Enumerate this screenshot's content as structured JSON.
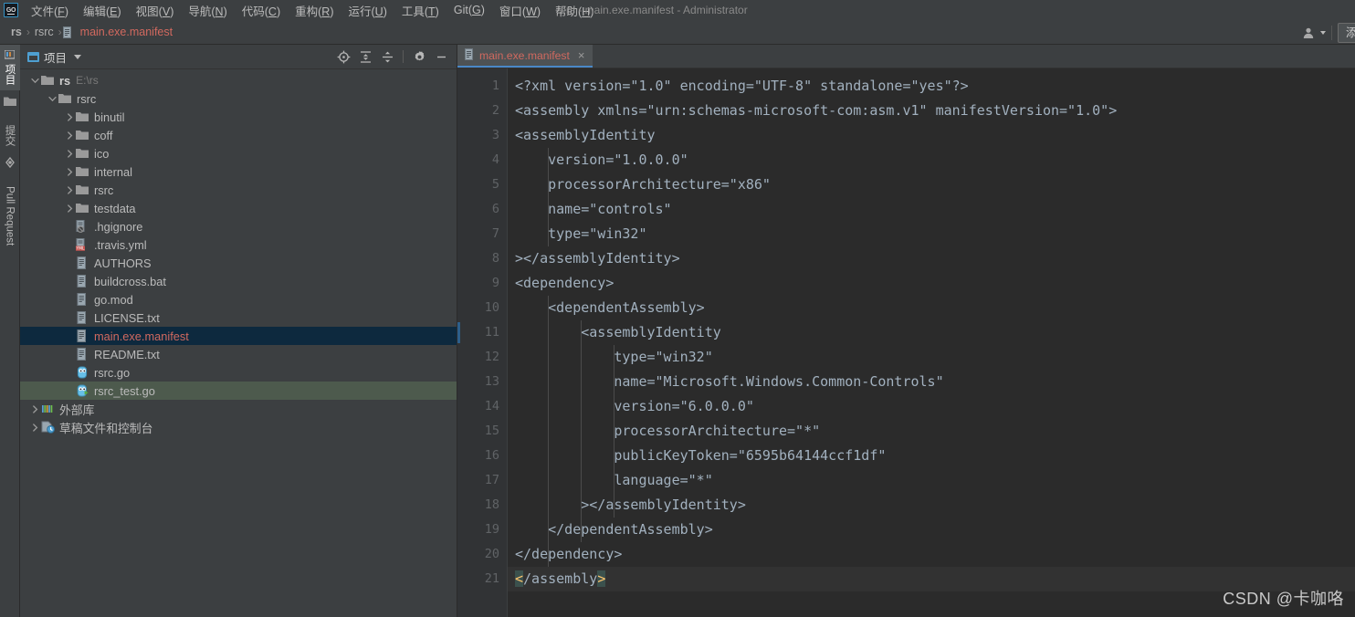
{
  "window": {
    "title": "rs - main.exe.manifest - Administrator",
    "logo_label": "GO"
  },
  "menubar": {
    "items": [
      {
        "label": "文件(F)",
        "name": "menu-file"
      },
      {
        "label": "编辑(E)",
        "name": "menu-edit"
      },
      {
        "label": "视图(V)",
        "name": "menu-view"
      },
      {
        "label": "导航(N)",
        "name": "menu-navigate"
      },
      {
        "label": "代码(C)",
        "name": "menu-code"
      },
      {
        "label": "重构(R)",
        "name": "menu-refactor"
      },
      {
        "label": "运行(U)",
        "name": "menu-run"
      },
      {
        "label": "工具(T)",
        "name": "menu-tools"
      },
      {
        "label": "Git(G)",
        "name": "menu-git"
      },
      {
        "label": "窗口(W)",
        "name": "menu-window"
      },
      {
        "label": "帮助(H)",
        "name": "menu-help"
      }
    ]
  },
  "breadcrumb": {
    "root": "rs",
    "folder": "rsrc",
    "file": "main.exe.manifest",
    "separator": "›"
  },
  "navbar_right": {
    "person_icon": "person-icon",
    "add_button_label": "添加"
  },
  "toolstrip": {
    "items": [
      {
        "label": "项目",
        "name": "toolwindow-project",
        "selected": true
      },
      {
        "label": "",
        "name": "toolwindow-folder",
        "icon": "folder-icon"
      },
      {
        "label": "提交",
        "name": "toolwindow-commit"
      },
      {
        "label": "",
        "name": "toolwindow-structure",
        "icon": "diamond-icon"
      },
      {
        "label": "Pull Request",
        "name": "toolwindow-pull-request"
      }
    ]
  },
  "project_panel": {
    "title": "项目",
    "tools": [
      {
        "name": "locate-icon",
        "title": "select-opened-file"
      },
      {
        "name": "expand-all-icon",
        "title": "expand-all"
      },
      {
        "name": "collapse-all-icon",
        "title": "collapse-all"
      },
      {
        "name": "gear-icon",
        "title": "settings"
      },
      {
        "name": "minimize-icon",
        "title": "hide"
      }
    ],
    "tree": [
      {
        "label": "rs",
        "sub": "E:\\rs",
        "depth": 0,
        "type": "module",
        "state": "expanded",
        "bold": true
      },
      {
        "label": "rsrc",
        "sub": "",
        "depth": 1,
        "type": "folder",
        "state": "expanded"
      },
      {
        "label": "binutil",
        "sub": "",
        "depth": 2,
        "type": "folder",
        "state": "collapsed"
      },
      {
        "label": "coff",
        "sub": "",
        "depth": 2,
        "type": "folder",
        "state": "collapsed"
      },
      {
        "label": "ico",
        "sub": "",
        "depth": 2,
        "type": "folder",
        "state": "collapsed"
      },
      {
        "label": "internal",
        "sub": "",
        "depth": 2,
        "type": "folder",
        "state": "collapsed"
      },
      {
        "label": "rsrc",
        "sub": "",
        "depth": 2,
        "type": "folder",
        "state": "collapsed"
      },
      {
        "label": "testdata",
        "sub": "",
        "depth": 2,
        "type": "folder",
        "state": "collapsed"
      },
      {
        "label": ".hgignore",
        "sub": "",
        "depth": 2,
        "type": "ignore",
        "state": "leaf"
      },
      {
        "label": ".travis.yml",
        "sub": "",
        "depth": 2,
        "type": "yml",
        "state": "leaf"
      },
      {
        "label": "AUTHORS",
        "sub": "",
        "depth": 2,
        "type": "text",
        "state": "leaf"
      },
      {
        "label": "buildcross.bat",
        "sub": "",
        "depth": 2,
        "type": "text",
        "state": "leaf"
      },
      {
        "label": "go.mod",
        "sub": "",
        "depth": 2,
        "type": "text",
        "state": "leaf"
      },
      {
        "label": "LICENSE.txt",
        "sub": "",
        "depth": 2,
        "type": "text",
        "state": "leaf"
      },
      {
        "label": "main.exe.manifest",
        "sub": "",
        "depth": 2,
        "type": "text",
        "state": "leaf",
        "selected": true
      },
      {
        "label": "README.txt",
        "sub": "",
        "depth": 2,
        "type": "text",
        "state": "leaf"
      },
      {
        "label": "rsrc.go",
        "sub": "",
        "depth": 2,
        "type": "go",
        "state": "leaf"
      },
      {
        "label": "rsrc_test.go",
        "sub": "",
        "depth": 2,
        "type": "gotest",
        "state": "leaf",
        "green": true
      },
      {
        "label": "外部库",
        "sub": "",
        "depth": 0,
        "type": "library",
        "state": "collapsed"
      },
      {
        "label": "草稿文件和控制台",
        "sub": "",
        "depth": 0,
        "type": "scratch",
        "state": "collapsed"
      }
    ]
  },
  "editor": {
    "tab": {
      "label": "main.exe.manifest",
      "close": "×"
    },
    "marked_line": 11,
    "current_line": 21,
    "lines": [
      {
        "n": 1,
        "text": "<?xml version=\"1.0\" encoding=\"UTF-8\" standalone=\"yes\"?>"
      },
      {
        "n": 2,
        "text": "<assembly xmlns=\"urn:schemas-microsoft-com:asm.v1\" manifestVersion=\"1.0\">"
      },
      {
        "n": 3,
        "text": "<assemblyIdentity"
      },
      {
        "n": 4,
        "text": "    version=\"1.0.0.0\""
      },
      {
        "n": 5,
        "text": "    processorArchitecture=\"x86\""
      },
      {
        "n": 6,
        "text": "    name=\"controls\""
      },
      {
        "n": 7,
        "text": "    type=\"win32\""
      },
      {
        "n": 8,
        "text": "></assemblyIdentity>"
      },
      {
        "n": 9,
        "text": "<dependency>"
      },
      {
        "n": 10,
        "text": "    <dependentAssembly>"
      },
      {
        "n": 11,
        "text": "        <assemblyIdentity"
      },
      {
        "n": 12,
        "text": "            type=\"win32\""
      },
      {
        "n": 13,
        "text": "            name=\"Microsoft.Windows.Common-Controls\""
      },
      {
        "n": 14,
        "text": "            version=\"6.0.0.0\""
      },
      {
        "n": 15,
        "text": "            processorArchitecture=\"*\""
      },
      {
        "n": 16,
        "text": "            publicKeyToken=\"6595b64144ccf1df\""
      },
      {
        "n": 17,
        "text": "            language=\"*\""
      },
      {
        "n": 18,
        "text": "        ></assemblyIdentity>"
      },
      {
        "n": 19,
        "text": "    </dependentAssembly>"
      },
      {
        "n": 20,
        "text": "</dependency>"
      },
      {
        "n": 21,
        "text": "</assembly>",
        "bracket_highlight": true
      }
    ]
  },
  "watermark": "CSDN @卡咖咯",
  "colors": {
    "panel_bg": "#3c3f41",
    "editor_bg": "#2b2b2b",
    "gutter_bg": "#313335",
    "selection_bg": "#0d293e",
    "green_row_bg": "#4d5a4d",
    "accent_blue": "#4a88c7",
    "file_red": "#d1695f",
    "code_fg": "#a2b1bf",
    "bracket_fg": "#ffc66d",
    "line_number_fg": "#606366"
  }
}
